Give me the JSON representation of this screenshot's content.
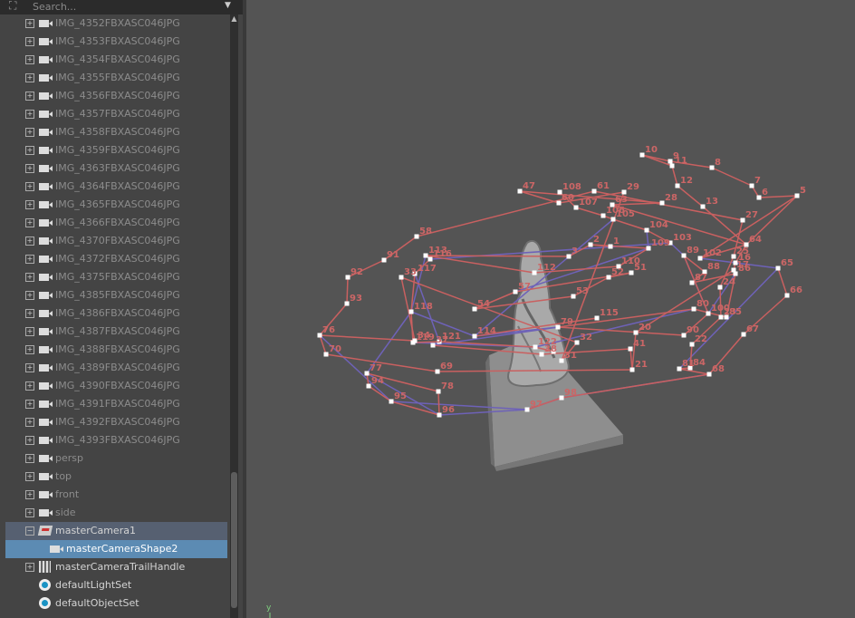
{
  "outliner": {
    "search_placeholder": "Search...",
    "items": [
      {
        "label": "IMG_4352FBXASC046JPG",
        "type": "camera",
        "expand": "+"
      },
      {
        "label": "IMG_4353FBXASC046JPG",
        "type": "camera",
        "expand": "+"
      },
      {
        "label": "IMG_4354FBXASC046JPG",
        "type": "camera",
        "expand": "+"
      },
      {
        "label": "IMG_4355FBXASC046JPG",
        "type": "camera",
        "expand": "+"
      },
      {
        "label": "IMG_4356FBXASC046JPG",
        "type": "camera",
        "expand": "+"
      },
      {
        "label": "IMG_4357FBXASC046JPG",
        "type": "camera",
        "expand": "+"
      },
      {
        "label": "IMG_4358FBXASC046JPG",
        "type": "camera",
        "expand": "+"
      },
      {
        "label": "IMG_4359FBXASC046JPG",
        "type": "camera",
        "expand": "+"
      },
      {
        "label": "IMG_4363FBXASC046JPG",
        "type": "camera",
        "expand": "+"
      },
      {
        "label": "IMG_4364FBXASC046JPG",
        "type": "camera",
        "expand": "+"
      },
      {
        "label": "IMG_4365FBXASC046JPG",
        "type": "camera",
        "expand": "+"
      },
      {
        "label": "IMG_4366FBXASC046JPG",
        "type": "camera",
        "expand": "+"
      },
      {
        "label": "IMG_4370FBXASC046JPG",
        "type": "camera",
        "expand": "+"
      },
      {
        "label": "IMG_4372FBXASC046JPG",
        "type": "camera",
        "expand": "+"
      },
      {
        "label": "IMG_4375FBXASC046JPG",
        "type": "camera",
        "expand": "+"
      },
      {
        "label": "IMG_4385FBXASC046JPG",
        "type": "camera",
        "expand": "+"
      },
      {
        "label": "IMG_4386FBXASC046JPG",
        "type": "camera",
        "expand": "+"
      },
      {
        "label": "IMG_4387FBXASC046JPG",
        "type": "camera",
        "expand": "+"
      },
      {
        "label": "IMG_4388FBXASC046JPG",
        "type": "camera",
        "expand": "+"
      },
      {
        "label": "IMG_4389FBXASC046JPG",
        "type": "camera",
        "expand": "+"
      },
      {
        "label": "IMG_4390FBXASC046JPG",
        "type": "camera",
        "expand": "+"
      },
      {
        "label": "IMG_4391FBXASC046JPG",
        "type": "camera",
        "expand": "+"
      },
      {
        "label": "IMG_4392FBXASC046JPG",
        "type": "camera",
        "expand": "+"
      },
      {
        "label": "IMG_4393FBXASC046JPG",
        "type": "camera",
        "expand": "+"
      },
      {
        "label": "persp",
        "type": "camera",
        "expand": "+"
      },
      {
        "label": "top",
        "type": "camera",
        "expand": "+"
      },
      {
        "label": "front",
        "type": "camera",
        "expand": "+"
      },
      {
        "label": "side",
        "type": "camera",
        "expand": "+"
      },
      {
        "label": "masterCamera1",
        "type": "mastercam",
        "expand": "−",
        "state": "expanded"
      },
      {
        "label": "masterCameraShape2",
        "type": "camera",
        "state": "selected"
      },
      {
        "label": "masterCameraTrailHandle",
        "type": "handle",
        "expand": "+"
      },
      {
        "label": "defaultLightSet",
        "type": "set"
      },
      {
        "label": "defaultObjectSet",
        "type": "set"
      }
    ]
  },
  "viewport": {
    "axis_label": "y",
    "colors": {
      "trail": "#c96060",
      "path": "#6e62b8",
      "point": "#ffffff",
      "background": "#545454"
    },
    "point_labels": [
      "1",
      "2",
      "3",
      "5",
      "6",
      "7",
      "8",
      "9",
      "10",
      "11",
      "12",
      "13",
      "16",
      "17",
      "20",
      "21",
      "22",
      "23",
      "24",
      "25",
      "27",
      "28",
      "29",
      "31",
      "32",
      "33",
      "34",
      "37",
      "38",
      "41",
      "47",
      "51",
      "52",
      "53",
      "54",
      "57",
      "58",
      "60",
      "61",
      "63",
      "64",
      "65",
      "66",
      "67",
      "68",
      "69",
      "70",
      "76",
      "77",
      "78",
      "79",
      "80",
      "81",
      "84",
      "85",
      "86",
      "87",
      "88",
      "89",
      "90",
      "91",
      "92",
      "93",
      "94",
      "95",
      "96",
      "97",
      "98",
      "100",
      "102",
      "103",
      "104",
      "105",
      "106",
      "107",
      "108",
      "109",
      "110",
      "112",
      "113",
      "114",
      "115",
      "116",
      "117",
      "118",
      "119",
      "121",
      "122"
    ]
  }
}
